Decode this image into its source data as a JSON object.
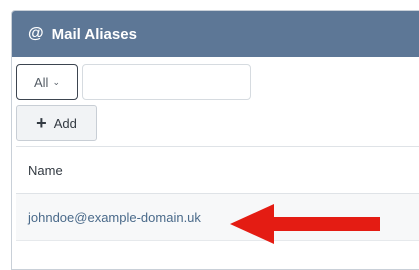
{
  "header": {
    "icon": "at-icon",
    "title": "Mail Aliases"
  },
  "filter": {
    "selected": "All",
    "input_value": "",
    "input_placeholder": ""
  },
  "toolbar": {
    "add_label": "Add"
  },
  "table": {
    "columns": [
      "Name"
    ],
    "rows": [
      {
        "name": "johndoe@example-domain.uk"
      }
    ]
  },
  "annotation": {
    "arrow_color": "#e41c13"
  }
}
